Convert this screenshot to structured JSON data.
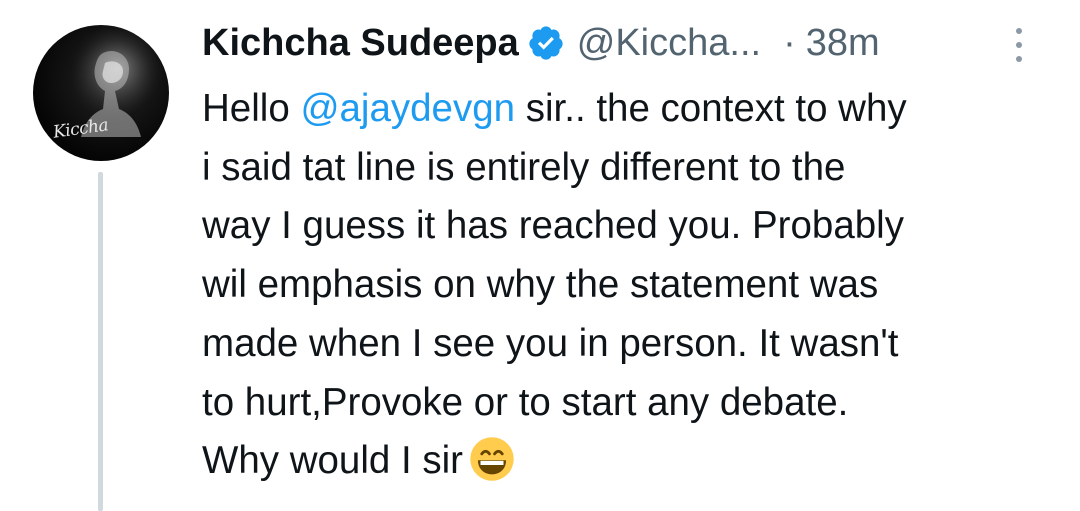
{
  "tweet": {
    "author_name": "Kichcha Sudeepa",
    "handle": "@Kiccha...",
    "separator": "·",
    "time": "38m",
    "avatar_logo_text": "Kiccha",
    "text_lines": [
      {
        "before": "Hello ",
        "mention": "@ajaydevgn",
        "after": " sir.. the context to why"
      },
      "i said tat line is entirely different to the",
      "way I guess it has reached you. Probably",
      "wil emphasis on why the statement was",
      "made when I see you in person. It wasn't",
      "to hurt,Provoke or to start any debate."
    ],
    "last_line": "Why would I sir",
    "colors": {
      "mention": "#1d9bf0",
      "verified": "#1d9bf0",
      "secondary_text": "#536471",
      "thread_line": "#cfd9de"
    },
    "icons": {
      "verified": "verified-badge-icon",
      "more": "more-options-icon",
      "emoji": "grinning-face-emoji"
    }
  }
}
